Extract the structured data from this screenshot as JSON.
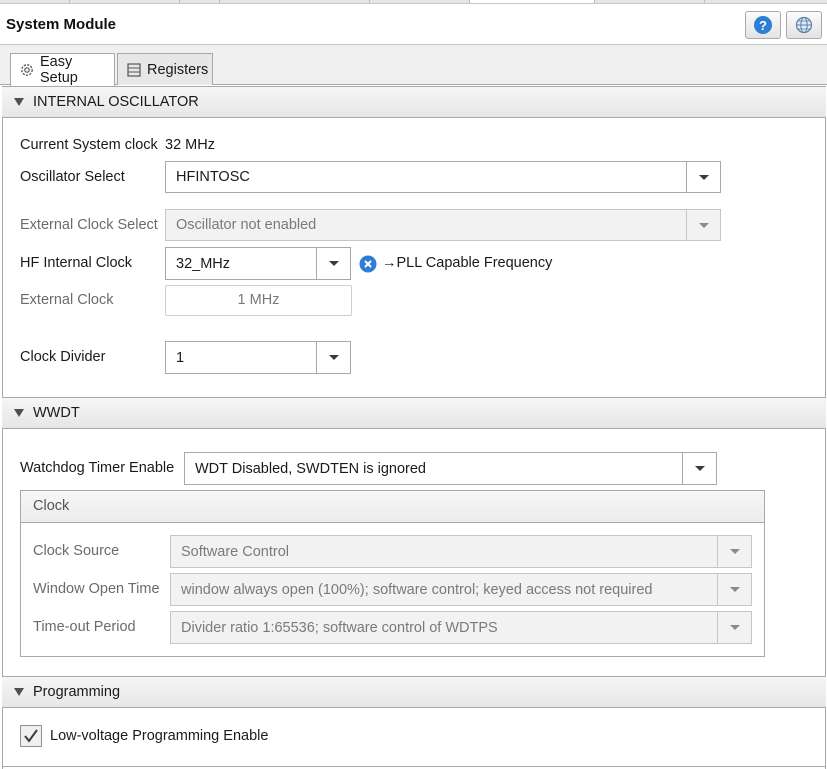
{
  "window": {
    "title": "System Module"
  },
  "header_buttons": {
    "help_label": "?"
  },
  "tabs": [
    {
      "label": "Easy Setup",
      "icon": "gear-icon",
      "active": true
    },
    {
      "label": "Registers",
      "icon": "list-icon",
      "active": false
    }
  ],
  "internal_oscillator": {
    "title": "INTERNAL OSCILLATOR",
    "current_clock_label": "Current System clock",
    "current_clock_value": "32 MHz",
    "oscillator_select": {
      "label": "Oscillator Select",
      "value": "HFINTOSC"
    },
    "external_clock_select": {
      "label": "External Clock Select",
      "value": "Oscillator not enabled"
    },
    "hf_internal_clock": {
      "label": "HF Internal Clock",
      "value": "32_MHz",
      "note": "→PLL Capable Frequency",
      "note_icon_color": "#2d7fd3"
    },
    "external_clock": {
      "label": "External Clock",
      "value": "1 MHz"
    },
    "clock_divider": {
      "label": "Clock Divider",
      "value": "1"
    }
  },
  "wwdt": {
    "title": "WWDT",
    "watchdog_enable": {
      "label": "Watchdog Timer Enable",
      "value": "WDT Disabled, SWDTEN is ignored"
    },
    "clock_group": {
      "title": "Clock",
      "clock_source": {
        "label": "Clock Source",
        "value": "Software Control"
      },
      "window_open_time": {
        "label": "Window Open Time",
        "value": "window always open (100%); software control; keyed access not required"
      },
      "timeout_period": {
        "label": "Time-out Period",
        "value": "Divider ratio 1:65536; software control of WDTPS"
      }
    }
  },
  "programming": {
    "title": "Programming",
    "lvp": {
      "label": "Low-voltage Programming Enable",
      "checked": true
    }
  }
}
